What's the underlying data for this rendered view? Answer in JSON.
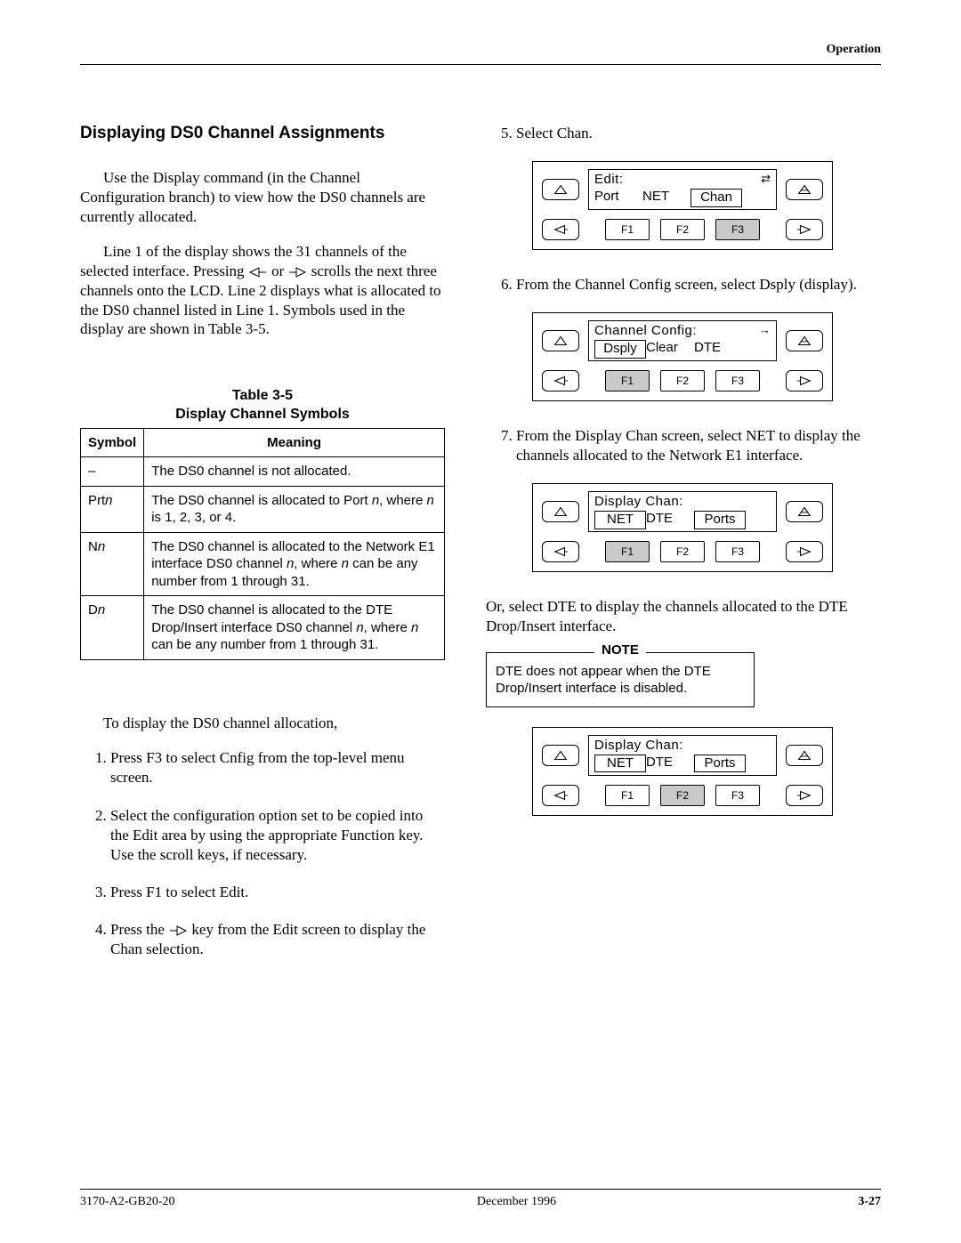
{
  "header": {
    "section_label": "Operation"
  },
  "section_heading": "Displaying DS0 Channel Assignments",
  "intro_para1": "Use the Display command (in the Channel Configuration branch) to view how the DS0 channels are currently allocated.",
  "intro_para2a": "Line 1 of the display shows the 31 channels of the selected interface. Pressing ",
  "intro_para2b": " or ",
  "intro_para2c": " scrolls the next three channels onto the LCD. Line 2 displays what is allocated to the DS0 channel listed in Line 1. Symbols used in the display are shown in Table 3-5.",
  "table": {
    "caption_line1": "Table 3-5",
    "caption_line2": "Display Channel Symbols",
    "head_symbol": "Symbol",
    "head_meaning": "Meaning",
    "rows": [
      {
        "sym_plain": "–",
        "sym_var": "",
        "meaning_html": "The DS0 channel is not allocated."
      },
      {
        "sym_plain": "Prt",
        "sym_var": "n",
        "meaning_html": "The DS0 channel is allocated to Port <i>n</i>, where <i>n</i> is 1, 2, 3, or 4."
      },
      {
        "sym_plain": "N",
        "sym_var": "n",
        "meaning_html": "The DS0 channel is allocated to the Network E1 interface DS0 channel <i>n</i>, where <i>n</i> can be any number from 1 through 31."
      },
      {
        "sym_plain": "D",
        "sym_var": "n",
        "meaning_html": "The DS0 channel is allocated to the DTE Drop/Insert interface DS0 channel <i>n</i>, where <i>n</i> can be any number from 1 through 31."
      }
    ]
  },
  "steps_intro": "To display the DS0 channel allocation,",
  "steps_left": [
    "Press F3 to select Cnfig from the top-level menu screen.",
    "Select the configuration option set to be copied into the Edit area by using the appropriate Function key. Use the scroll keys, if necessary.",
    "Press F1 to select Edit.",
    "Press the  ▷  key from the Edit screen to display the Chan selection."
  ],
  "right_steps": {
    "s5": "Select Chan.",
    "s6": "From the Channel Config screen, select Dsply (display).",
    "s7": "From the Display Chan screen, select NET to display the channels allocated to the Network E1 interface."
  },
  "after_lcd3_para": "Or, select DTE to display the channels allocated to the DTE Drop/Insert interface.",
  "note": {
    "title": "NOTE",
    "body": "DTE does not appear when the DTE Drop/Insert interface is disabled."
  },
  "lcd_panels": [
    {
      "line1": "Edit:",
      "opts": [
        {
          "label": "Port",
          "highlight": false
        },
        {
          "label": "NET",
          "highlight": false
        },
        {
          "label": "Chan",
          "highlight": true
        }
      ],
      "arrow": "⇄",
      "fkeys_active": [
        false,
        false,
        true
      ]
    },
    {
      "line1": "Channel Config:",
      "opts": [
        {
          "label": "Dsply",
          "highlight": true
        },
        {
          "label": "Clear",
          "highlight": false
        },
        {
          "label": "DTE",
          "highlight": false
        }
      ],
      "arrow": "→",
      "fkeys_active": [
        true,
        false,
        false
      ]
    },
    {
      "line1": "Display Chan:",
      "opts": [
        {
          "label": "NET",
          "highlight": true
        },
        {
          "label": "DTE",
          "highlight": false
        },
        {
          "label": "Ports",
          "highlight": true
        }
      ],
      "arrow": "",
      "fkeys_active": [
        true,
        false,
        false
      ]
    },
    {
      "line1": "Display Chan:",
      "opts": [
        {
          "label": "NET",
          "highlight": true
        },
        {
          "label": "DTE",
          "highlight": false
        },
        {
          "label": "Ports",
          "highlight": true
        }
      ],
      "arrow": "",
      "fkeys_active": [
        false,
        true,
        false
      ]
    }
  ],
  "fkey_labels": [
    "F1",
    "F2",
    "F3"
  ],
  "footer": {
    "left": "3170-A2-GB20-20",
    "center": "December 1996",
    "right": "3-27"
  }
}
